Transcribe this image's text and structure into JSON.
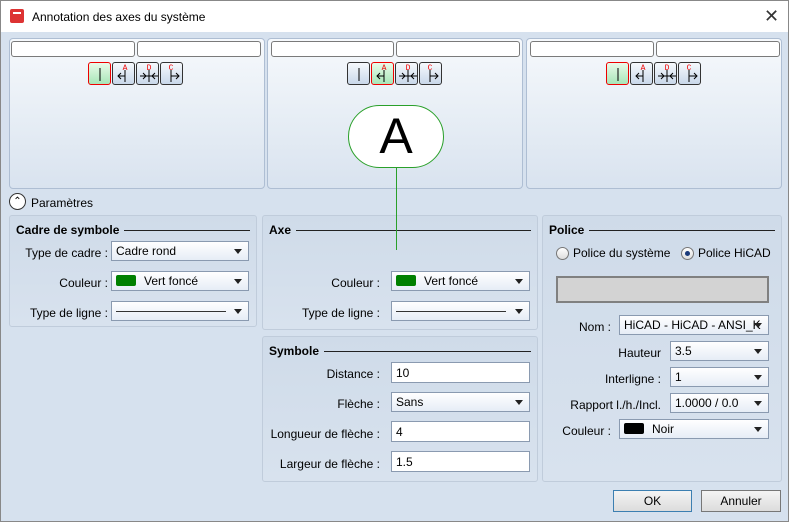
{
  "title": "Annotation des axes du système",
  "params_label": "Paramètres",
  "preview": {
    "letter": "A",
    "accent": "#2aa02a"
  },
  "cadre": {
    "title": "Cadre de symbole",
    "type_label": "Type de cadre :",
    "type_value": "Cadre rond",
    "color_label": "Couleur :",
    "color_value": "Vert foncé",
    "color_hex": "#008000",
    "line_label": "Type de ligne :"
  },
  "axe": {
    "title": "Axe",
    "color_label": "Couleur :",
    "color_value": "Vert foncé",
    "line_label": "Type de ligne :"
  },
  "symbole": {
    "title": "Symbole",
    "distance_label": "Distance :",
    "distance": "10",
    "fleche_label": "Flèche :",
    "fleche": "Sans",
    "longueur_label": "Longueur de flèche :",
    "longueur": "4",
    "largeur_label": "Largeur de flèche :",
    "largeur": "1.5"
  },
  "police": {
    "title": "Police",
    "radio_system": "Police du système",
    "radio_hicad": "Police HiCAD",
    "nom_label": "Nom :",
    "nom": "HiCAD - HiCAD - ANSI_K",
    "hauteur_label": "Hauteur",
    "hauteur": "3.5",
    "interligne_label": "Interligne :",
    "interligne": "1",
    "rapport_label": "Rapport l./h./Incl.",
    "rapport": "1.0000 / 0.0",
    "couleur_label": "Couleur :",
    "couleur": "Noir"
  },
  "buttons": {
    "ok": "OK",
    "cancel": "Annuler"
  },
  "letters": [
    "A",
    "D",
    "C"
  ]
}
